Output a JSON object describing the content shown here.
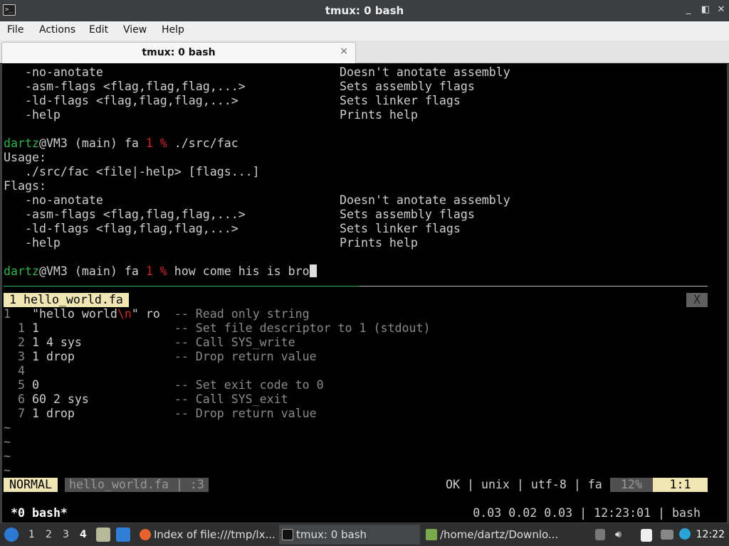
{
  "window": {
    "title": "tmux: 0 bash",
    "buttons": [
      "_",
      "◧",
      "✕"
    ]
  },
  "menubar": [
    "File",
    "Actions",
    "Edit",
    "View",
    "Help"
  ],
  "tab": {
    "label": "tmux: 0 bash",
    "close": "×"
  },
  "terminal": {
    "top_lines": [
      {
        "left": "   -no-anotate",
        "right": "Doesn't anotate assembly"
      },
      {
        "left": "   -asm-flags <flag,flag,flag,...>",
        "right": "Sets assembly flags"
      },
      {
        "left": "   -ld-flags <flag,flag,flag,...>",
        "right": "Sets linker flags"
      },
      {
        "left": "   -help",
        "right": "Prints help"
      }
    ],
    "prompt1": {
      "user": "dartz",
      "host": "@VM3 (main) fa ",
      "code": "1 %",
      "cmd": " ./src/fac"
    },
    "usage_lines": [
      "Usage:",
      "   ./src/fac <file|-help> [flags...]",
      "Flags:"
    ],
    "flag_lines": [
      {
        "left": "   -no-anotate",
        "right": "Doesn't anotate assembly"
      },
      {
        "left": "   -asm-flags <flag,flag,flag,...>",
        "right": "Sets assembly flags"
      },
      {
        "left": "   -ld-flags <flag,flag,flag,...>",
        "right": "Sets linker flags"
      },
      {
        "left": "   -help",
        "right": "Prints help"
      }
    ],
    "prompt2": {
      "user": "dartz",
      "host": "@VM3 (main) fa ",
      "code": "1 %",
      "cmd": " how come his is bro"
    }
  },
  "vim": {
    "buffer_tab": "1 hello_world.fa",
    "buffer_close": "X",
    "lines": [
      {
        "num": "1 ",
        "code_pre": "  \"hello world",
        "esc": "\\n",
        "code_post": "\" ro  ",
        "comment": "-- Read only string"
      },
      {
        "num": "  1 ",
        "code_pre": "1                   ",
        "esc": "",
        "code_post": "",
        "comment": "-- Set file descriptor to 1 (stdout)"
      },
      {
        "num": "  2 ",
        "code_pre": "1 4 sys             ",
        "esc": "",
        "code_post": "",
        "comment": "-- Call SYS_write"
      },
      {
        "num": "  3 ",
        "code_pre": "1 drop              ",
        "esc": "",
        "code_post": "",
        "comment": "-- Drop return value"
      },
      {
        "num": "  4 ",
        "code_pre": "",
        "esc": "",
        "code_post": "",
        "comment": ""
      },
      {
        "num": "  5 ",
        "code_pre": "0                   ",
        "esc": "",
        "code_post": "",
        "comment": "-- Set exit code to 0"
      },
      {
        "num": "  6 ",
        "code_pre": "60 2 sys            ",
        "esc": "",
        "code_post": "",
        "comment": "-- Call SYS_exit"
      },
      {
        "num": "  7 ",
        "code_pre": "1 drop              ",
        "esc": "",
        "code_post": "",
        "comment": "-- Drop return value"
      }
    ],
    "tildes": [
      "~",
      "~",
      "~",
      "~"
    ],
    "status": {
      "mode": "NORMAL",
      "file": "hello_world.fa | :3",
      "info": "OK | unix | utf-8 | fa",
      "percent": "12%",
      "position": "1:1"
    }
  },
  "tmux": {
    "window": "*0 bash*",
    "right": "0.03 0.02 0.03 | 12:23:01 | bash"
  },
  "taskbar": {
    "workspaces": [
      "1",
      "2",
      "3",
      "4"
    ],
    "active_workspace": "4",
    "tasks": [
      {
        "label": "Index of file:///tmp/lx..."
      },
      {
        "label": "tmux: 0 bash"
      },
      {
        "label": "/home/dartz/Downlo..."
      }
    ],
    "clock": "12:22"
  }
}
